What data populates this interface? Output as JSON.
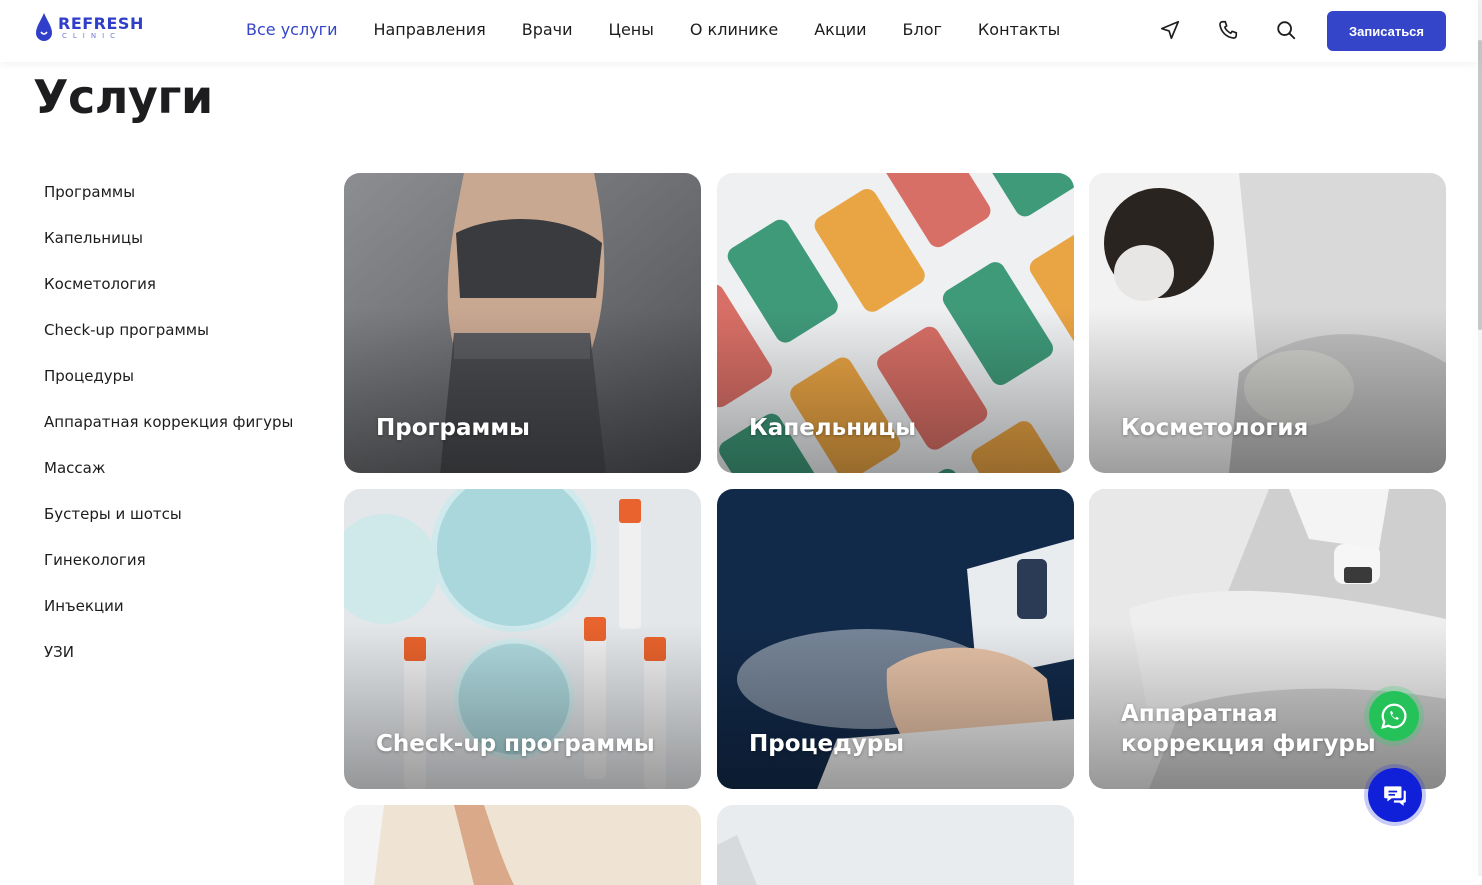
{
  "logo": {
    "name": "REFRESH",
    "sub": "CLINIC"
  },
  "nav": [
    {
      "label": "Все услуги",
      "active": true
    },
    {
      "label": "Направления"
    },
    {
      "label": "Врачи"
    },
    {
      "label": "Цены"
    },
    {
      "label": "О клинике"
    },
    {
      "label": "Акции"
    },
    {
      "label": "Блог"
    },
    {
      "label": "Контакты"
    }
  ],
  "header_icons": [
    "location-icon",
    "phone-icon",
    "search-icon"
  ],
  "cta_label": "Записаться",
  "page_title": "Услуги",
  "sidebar": [
    "Программы",
    "Капельницы",
    "Косметология",
    "Check-up программы",
    "Процедуры",
    "Аппаратная коррекция фигуры",
    "Массаж",
    "Бустеры и шотсы",
    "Гинекология",
    "Инъекции",
    "УЗИ"
  ],
  "cards": [
    {
      "label": "Программы"
    },
    {
      "label": "Капельницы"
    },
    {
      "label": "Косметология"
    },
    {
      "label": "Check-up программы"
    },
    {
      "label": "Процедуры"
    },
    {
      "label": "Аппаратная коррекция фигуры"
    },
    {
      "label": ""
    },
    {
      "label": ""
    }
  ],
  "colors": {
    "accent": "#3545c9",
    "whatsapp": "#25c25a",
    "chat": "#1020d8"
  }
}
